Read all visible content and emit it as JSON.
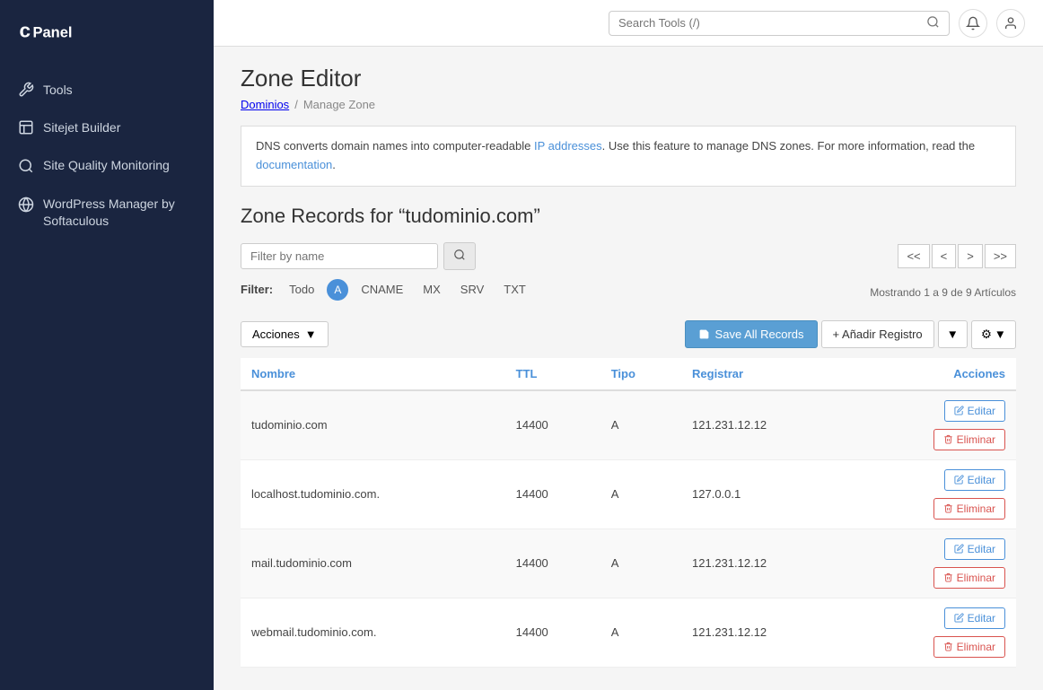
{
  "sidebar": {
    "logo_alt": "cPanel",
    "items": [
      {
        "id": "tools",
        "label": "Tools",
        "icon": "wrench-icon"
      },
      {
        "id": "sitejet",
        "label": "Sitejet Builder",
        "icon": "sitejet-icon"
      },
      {
        "id": "site-quality",
        "label": "Site Quality Monitoring",
        "icon": "search-quality-icon"
      },
      {
        "id": "wordpress",
        "label": "WordPress Manager by Softaculous",
        "icon": "wordpress-icon"
      }
    ]
  },
  "topbar": {
    "search_placeholder": "Search Tools (/)",
    "notifications_icon": "bell-icon",
    "user_icon": "user-icon"
  },
  "page": {
    "title": "Zone Editor",
    "breadcrumb_parent": "Dominios",
    "breadcrumb_separator": "/",
    "breadcrumb_current": "Manage Zone",
    "description_part1": "DNS converts domain names into computer-readable ",
    "description_link_text": "IP addresses",
    "description_part2": ". Use this feature to manage DNS zones. For more information, read the ",
    "description_doc_link": "documentation",
    "description_end": ".",
    "zone_title": "Zone Records for “tudominio.com”"
  },
  "filter": {
    "placeholder": "Filter by name",
    "label": "Filter:",
    "filter_all": "Todo",
    "filter_a": "A",
    "filter_cname": "CNAME",
    "filter_mx": "MX",
    "filter_srv": "SRV",
    "filter_txt": "TXT",
    "info": "Mostrando 1 a 9 de 9 Artículos",
    "pagination": {
      "first": "<<",
      "prev": "<",
      "next": ">",
      "last": ">>"
    }
  },
  "toolbar": {
    "acciones_label": "Acciones",
    "save_label": "Save All Records",
    "add_label": "+ Añadir Registro",
    "dropdown_arrow": "▼",
    "gear_label": "⚙"
  },
  "table": {
    "headers": {
      "nombre": "Nombre",
      "ttl": "TTL",
      "tipo": "Tipo",
      "registrar": "Registrar",
      "acciones": "Acciones"
    },
    "btn_edit": "Editar",
    "btn_delete": "Eliminar",
    "rows": [
      {
        "nombre": "tudominio.com",
        "ttl": "14400",
        "tipo": "A",
        "registrar": "121.231.12.12"
      },
      {
        "nombre": "localhost.tudominio.com.",
        "ttl": "14400",
        "tipo": "A",
        "registrar": "127.0.0.1"
      },
      {
        "nombre": "mail.tudominio.com",
        "ttl": "14400",
        "tipo": "A",
        "registrar": "121.231.12.12"
      },
      {
        "nombre": "webmail.tudominio.com.",
        "ttl": "14400",
        "tipo": "A",
        "registrar": "121.231.12.12"
      }
    ]
  }
}
